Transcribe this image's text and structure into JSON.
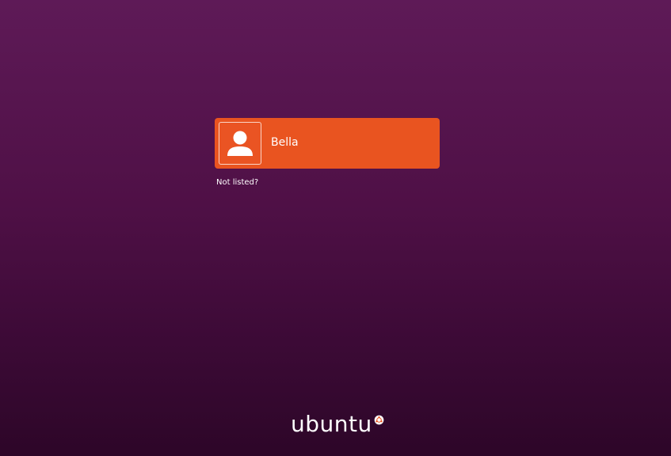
{
  "colors": {
    "accent": "#e95420",
    "background_top": "#5e1a57",
    "background_bottom": "#2d0628",
    "text": "#ffffff"
  },
  "user_list": {
    "users": [
      {
        "name": "Bella",
        "avatar_icon": "user-silhouette-icon",
        "selected": true
      }
    ]
  },
  "not_listed": {
    "label": "Not listed?"
  },
  "branding": {
    "wordmark": "ubuntu",
    "logo_icon": "circle-of-friends-icon"
  }
}
